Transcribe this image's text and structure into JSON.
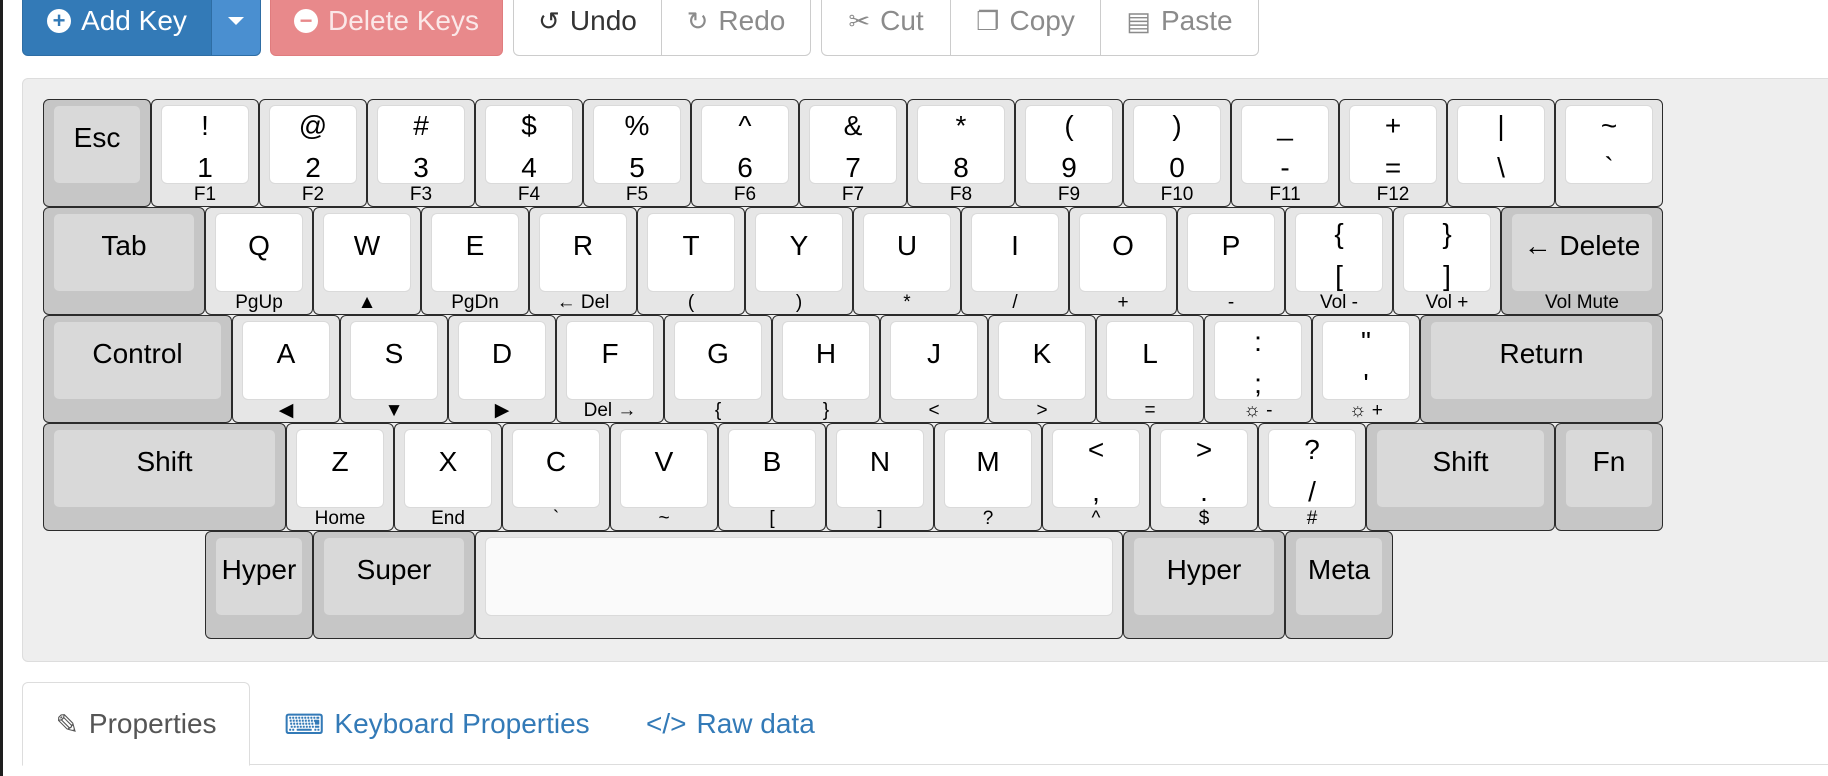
{
  "toolbar": {
    "add_key": "Add Key",
    "delete_keys": "Delete Keys",
    "undo": "Undo",
    "redo": "Redo",
    "cut": "Cut",
    "copy": "Copy",
    "paste": "Paste"
  },
  "keyboard": {
    "keys": [
      {
        "c": "Esc",
        "g": 1
      },
      {
        "t": "!",
        "b": "1",
        "f": "F1"
      },
      {
        "t": "@",
        "b": "2",
        "f": "F2"
      },
      {
        "t": "#",
        "b": "3",
        "f": "F3"
      },
      {
        "t": "$",
        "b": "4",
        "f": "F4"
      },
      {
        "t": "%",
        "b": "5",
        "f": "F5"
      },
      {
        "t": "^",
        "b": "6",
        "f": "F6"
      },
      {
        "t": "&",
        "b": "7",
        "f": "F7"
      },
      {
        "t": "*",
        "b": "8",
        "f": "F8"
      },
      {
        "t": "(",
        "b": "9",
        "f": "F9"
      },
      {
        "t": ")",
        "b": "0",
        "f": "F10"
      },
      {
        "t": "_",
        "b": "-",
        "f": "F11"
      },
      {
        "t": "+",
        "b": "=",
        "f": "F12"
      },
      {
        "t": "|",
        "b": "\\"
      },
      {
        "t": "~",
        "b": "`"
      },
      {
        "c": "Tab",
        "g": 1
      },
      {
        "c": "Q",
        "f": "PgUp"
      },
      {
        "c": "W",
        "f": "▲"
      },
      {
        "c": "E",
        "f": "PgDn"
      },
      {
        "c": "R",
        "f": "← Del"
      },
      {
        "c": "T",
        "f": "("
      },
      {
        "c": "Y",
        "f": ")"
      },
      {
        "c": "U",
        "f": "*"
      },
      {
        "c": "I",
        "f": "/"
      },
      {
        "c": "O",
        "f": "+"
      },
      {
        "c": "P",
        "f": "-"
      },
      {
        "t": "{",
        "b": "[",
        "f": "Vol -"
      },
      {
        "t": "}",
        "b": "]",
        "f": "Vol +"
      },
      {
        "c": "← Delete",
        "f": "Vol Mute",
        "g": 1
      },
      {
        "c": "Control",
        "g": 1
      },
      {
        "c": "A",
        "f": "◀"
      },
      {
        "c": "S",
        "f": "▼"
      },
      {
        "c": "D",
        "f": "▶"
      },
      {
        "c": "F",
        "f": "Del →"
      },
      {
        "c": "G",
        "f": "{"
      },
      {
        "c": "H",
        "f": "}"
      },
      {
        "c": "J",
        "f": "<"
      },
      {
        "c": "K",
        "f": ">"
      },
      {
        "c": "L",
        "f": "="
      },
      {
        "t": ":",
        "b": ";",
        "f": "☼ -"
      },
      {
        "t": "\"",
        "b": "'",
        "f": "☼ +"
      },
      {
        "c": "Return",
        "g": 1
      },
      {
        "c": "Shift",
        "g": 1
      },
      {
        "c": "Z",
        "f": "Home"
      },
      {
        "c": "X",
        "f": "End"
      },
      {
        "c": "C",
        "f": "`"
      },
      {
        "c": "V",
        "f": "~"
      },
      {
        "c": "B",
        "f": "["
      },
      {
        "c": "N",
        "f": "]"
      },
      {
        "c": "M",
        "f": "?"
      },
      {
        "t": "<",
        "b": ",",
        "f": "^"
      },
      {
        "t": ">",
        "b": ".",
        "f": "$"
      },
      {
        "t": "?",
        "b": "/",
        "f": "#"
      },
      {
        "c": "Shift",
        "g": 1
      },
      {
        "c": "Fn",
        "g": 1
      },
      {
        "c": "Hyper",
        "g": 1
      },
      {
        "c": "Super",
        "g": 1
      },
      {
        "c": "",
        "s": 1
      },
      {
        "c": "Hyper",
        "g": 1
      },
      {
        "c": "Meta",
        "g": 1
      }
    ]
  },
  "tabs": {
    "properties": "Properties",
    "keyboard_properties": "Keyboard Properties",
    "raw_data": "Raw data"
  },
  "colors": {
    "primary": "#337ab7",
    "danger": "#e8898b",
    "key_gray": "#d9d9d9",
    "keyboard_bg": "#eeeeee"
  }
}
